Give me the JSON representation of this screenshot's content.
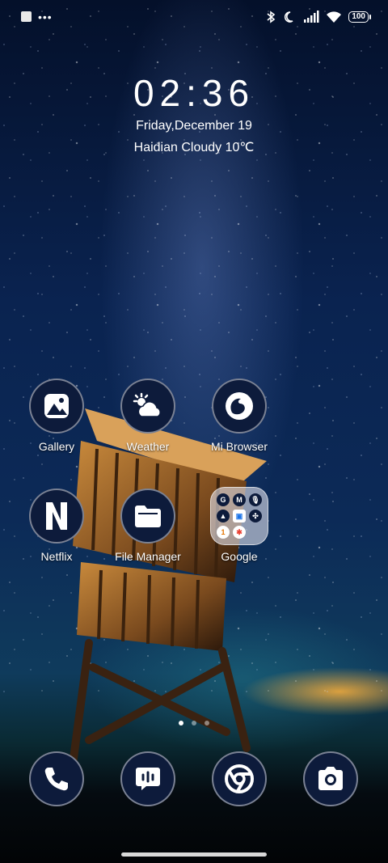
{
  "status_bar": {
    "battery_level": "100",
    "icons": [
      "notification-square-icon",
      "more-dots-icon",
      "bluetooth-icon",
      "do-not-disturb-moon-icon",
      "cellular-signal-icon",
      "wifi-icon",
      "battery-icon"
    ]
  },
  "clock_widget": {
    "time": "02:36",
    "date": "Friday,December 19",
    "weather": "Haidian Cloudy 10℃"
  },
  "apps": [
    {
      "label": "Gallery",
      "icon": "gallery-icon"
    },
    {
      "label": "Weather",
      "icon": "weather-sun-cloud-icon"
    },
    {
      "label": "Mi Browser",
      "icon": "mi-browser-icon"
    },
    {
      "label": "Netflix",
      "icon": "netflix-icon"
    },
    {
      "label": "File Manager",
      "icon": "folder-icon"
    },
    {
      "label": "Google",
      "icon": "google-folder-icon"
    }
  ],
  "google_folder_items": [
    "G",
    "M",
    "🎙",
    "▲",
    "▣",
    "✣",
    "1",
    "✱",
    ""
  ],
  "page_indicator": {
    "pages": 3,
    "active": 1
  },
  "dock": [
    {
      "name": "phone",
      "icon": "phone-icon"
    },
    {
      "name": "messages",
      "icon": "message-icon"
    },
    {
      "name": "chrome",
      "icon": "chrome-icon"
    },
    {
      "name": "camera",
      "icon": "camera-icon"
    }
  ]
}
